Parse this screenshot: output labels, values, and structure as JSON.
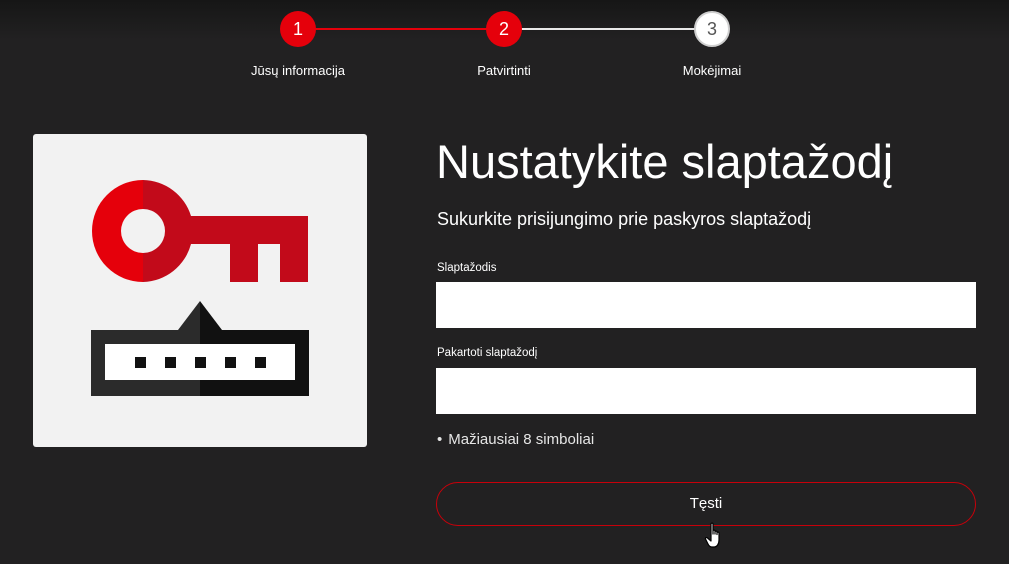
{
  "stepper": {
    "steps": [
      {
        "number": "1",
        "label": "Jūsų informacija",
        "state": "completed"
      },
      {
        "number": "2",
        "label": "Patvirtinti",
        "state": "active"
      },
      {
        "number": "3",
        "label": "Mokėjimai",
        "state": "pending"
      }
    ]
  },
  "illustration": {
    "icon": "key-and-password-icon",
    "colors": {
      "key_red": "#e5000b",
      "key_dark_red": "#c20a1a",
      "box_dark": "#2b2b2b",
      "box_shadow": "#111111"
    }
  },
  "form": {
    "title": "Nustatykite slaptažodį",
    "subtitle": "Sukurkite prisijungimo prie paskyros slaptažodį",
    "password_label": "Slaptažodis",
    "password_value": "",
    "repeat_label": "Pakartoti slaptažodį",
    "repeat_value": "",
    "hint": "Mažiausiai 8 simboliai",
    "continue_label": "Tęsti"
  },
  "colors": {
    "accent": "#e5000b",
    "background": "#222122"
  }
}
